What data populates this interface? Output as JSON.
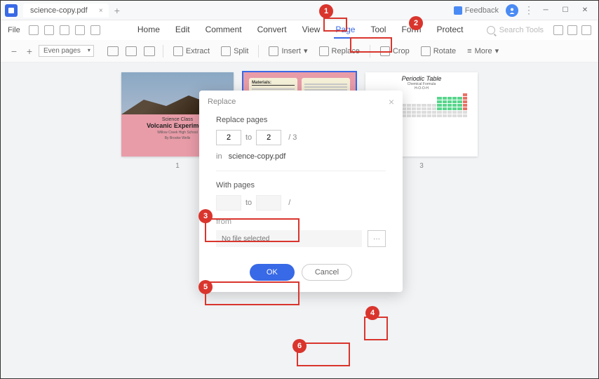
{
  "titlebar": {
    "tab_name": "science-copy.pdf",
    "feedback": "Feedback"
  },
  "menubar": {
    "file": "File",
    "items": [
      "Home",
      "Edit",
      "Comment",
      "Convert",
      "View",
      "Page",
      "Tool",
      "Form",
      "Protect"
    ],
    "active_index": 5,
    "search_placeholder": "Search Tools"
  },
  "toolbar": {
    "page_mode": "Even pages",
    "extract": "Extract",
    "split": "Split",
    "insert": "Insert",
    "replace": "Replace",
    "crop": "Crop",
    "rotate": "Rotate",
    "more": "More"
  },
  "thumbs": {
    "t1": {
      "science": "Science Class",
      "title": "Volcanic Experiment",
      "school": "Willow Creek High School",
      "by": "By Brooke Wells"
    },
    "t2": {
      "materials": "Materials:"
    },
    "t3": {
      "title": "Periodic Table",
      "sub1": "Chemical Formula",
      "sub2": "H-O-O-H"
    },
    "nums": [
      "1",
      "",
      "3"
    ]
  },
  "dialog": {
    "title": "Replace",
    "replace_pages": "Replace pages",
    "from_val": "2",
    "to_val": "2",
    "to": "to",
    "total": "/ 3",
    "in": "in",
    "filename": "science-copy.pdf",
    "with_pages": "With pages",
    "with_from": "",
    "with_to": "",
    "with_total": "/",
    "from": "from",
    "no_file": "No file selected",
    "browse": "···",
    "ok": "OK",
    "cancel": "Cancel"
  },
  "badges": [
    "1",
    "2",
    "3",
    "4",
    "5",
    "6"
  ]
}
